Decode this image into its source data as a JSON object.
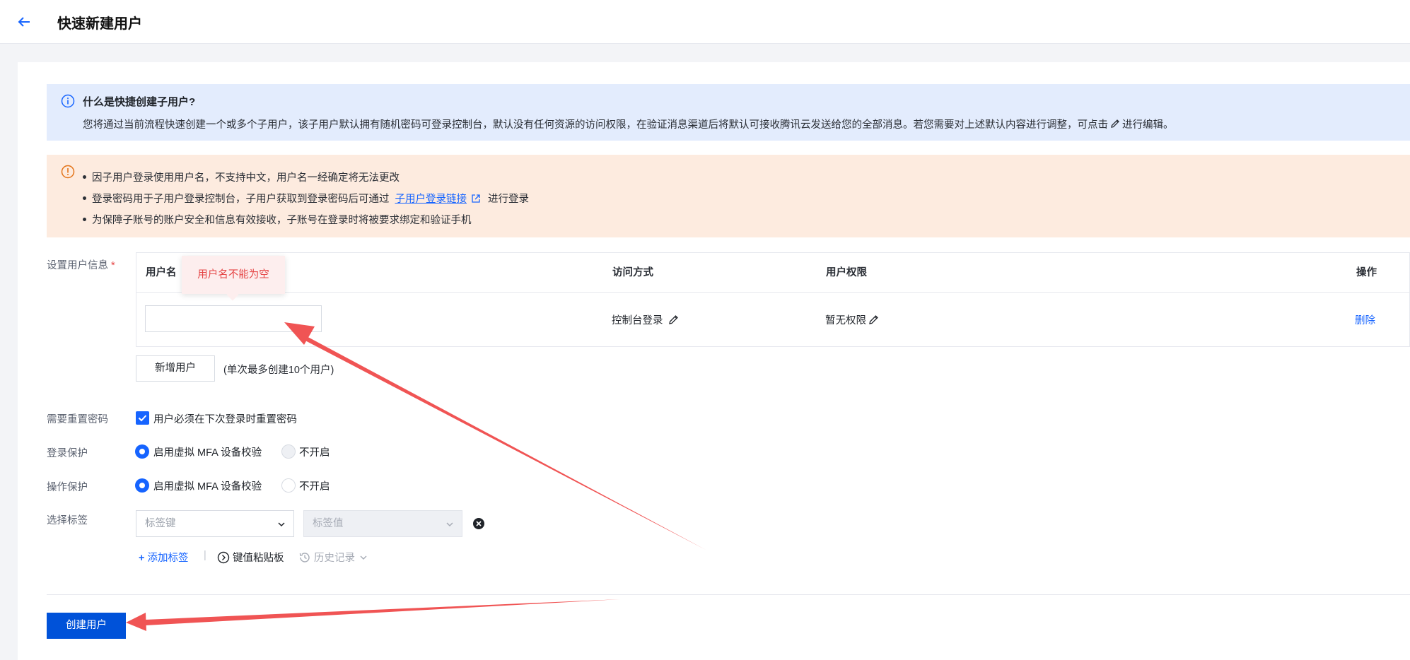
{
  "header": {
    "title": "快速新建用户"
  },
  "info": {
    "title": "什么是快捷创建子用户?",
    "text_before": "您将通过当前流程快速创建一个或多个子用户，该子用户默认拥有随机密码可登录控制台，默认没有任何资源的访问权限，在验证消息渠道后将默认可接收腾讯云发送给您的全部消息。若您需要对上述默认内容进行调整，可点击",
    "text_after": "进行编辑。"
  },
  "warning": {
    "line1": "因子用户登录使用用户名，不支持中文，用户名一经确定将无法更改",
    "line2_before": "登录密码用于子用户登录控制台，子用户获取到登录密码后可通过",
    "line2_link": "子用户登录链接",
    "line2_after": "进行登录",
    "line3": "为保障子账号的账户安全和信息有效接收，子账号在登录时将被要求绑定和验证手机"
  },
  "user_info": {
    "label": "设置用户信息",
    "required_mark": "*",
    "columns": [
      "用户名",
      "访问方式",
      "用户权限",
      "操作"
    ],
    "row": {
      "username": "",
      "access": "控制台登录",
      "permission": "暂无权限",
      "action": "删除"
    },
    "tooltip": "用户名不能为空",
    "add_button": "新增用户",
    "limit_hint": "(单次最多创建10个用户)"
  },
  "reset_password": {
    "label": "需要重置密码",
    "checkbox_text": "用户必须在下次登录时重置密码",
    "checked": true
  },
  "login_protect": {
    "label": "登录保护",
    "option_on": "启用虚拟 MFA 设备校验",
    "option_off": "不开启",
    "selected": "on"
  },
  "op_protect": {
    "label": "操作保护",
    "option_on": "启用虚拟 MFA 设备校验",
    "option_off": "不开启",
    "selected": "on"
  },
  "tags": {
    "label": "选择标签",
    "key_placeholder": "标签键",
    "value_placeholder": "标签值",
    "add_tag": "添加标签",
    "separator": "|",
    "kv_board": "键值粘贴板",
    "history": "历史记录"
  },
  "submit": {
    "label": "创建用户"
  },
  "colors": {
    "primary": "#0052d9",
    "link": "#1664ff",
    "error": "#e54545",
    "annotation": "#f05454"
  }
}
